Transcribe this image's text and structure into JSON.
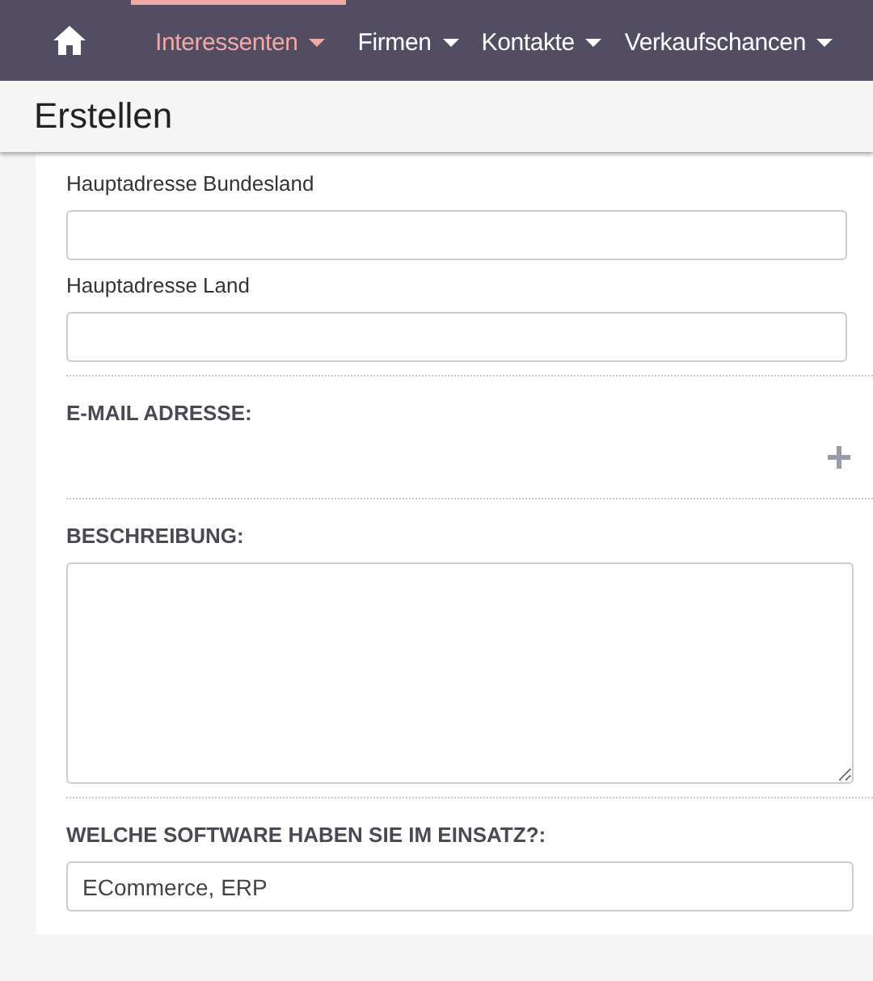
{
  "nav": {
    "tabs": [
      {
        "label": "Interessenten",
        "selected": true
      },
      {
        "label": "Firmen",
        "selected": false
      },
      {
        "label": "Kontakte",
        "selected": false
      },
      {
        "label": "Verkaufschancen",
        "selected": false
      }
    ]
  },
  "page_title": "Erstellen",
  "form": [
    {
      "kind": "field",
      "label": "Hauptadresse Bundesland"
    },
    {
      "kind": "field",
      "label": "Hauptadresse Land"
    },
    {
      "kind": "add_list",
      "label": "E-MAIL ADRESSE:"
    },
    {
      "kind": "textarea",
      "label": "BESCHREIBUNG:"
    },
    {
      "kind": "section_field",
      "label": "WELCHE SOFTWARE HABEN SIE IM EINSATZ?:",
      "value": "ECommerce, ERP"
    }
  ]
}
